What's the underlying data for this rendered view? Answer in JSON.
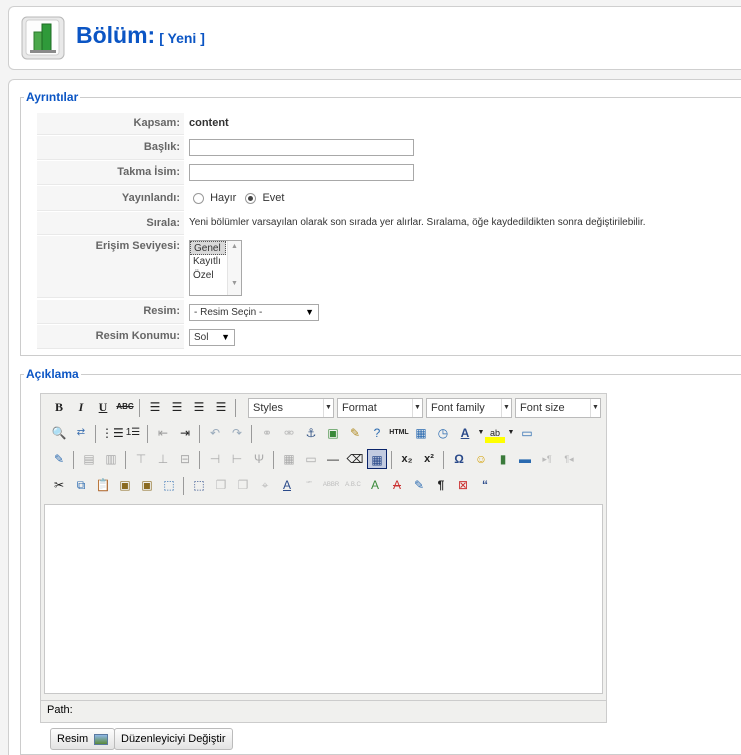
{
  "header": {
    "title": "Bölüm:",
    "subtitle": "[ Yeni ]"
  },
  "details": {
    "legend": "Ayrıntılar",
    "scope_label": "Kapsam:",
    "scope_value": "content",
    "title_label": "Başlık:",
    "title_value": "",
    "alias_label": "Takma İsim:",
    "alias_value": "",
    "published_label": "Yayınlandı:",
    "published_no": "Hayır",
    "published_yes": "Evet",
    "order_label": "Sırala:",
    "order_text": "Yeni bölümler varsayılan olarak son sırada yer alırlar. Sıralama, öğe kaydedildikten sonra değiştirilebilir.",
    "access_label": "Erişim Seviyesi:",
    "access_options": [
      "Genel",
      "Kayıtlı",
      "Özel"
    ],
    "image_label": "Resim:",
    "image_selected": "- Resim Seçin -",
    "image_pos_label": "Resim Konumu:",
    "image_pos_selected": "Sol"
  },
  "description": {
    "legend": "Açıklama",
    "styles_dd": "Styles",
    "format_dd": "Format",
    "font_family_dd": "Font family",
    "font_size_dd": "Font size",
    "path_label": "Path:"
  },
  "buttons": {
    "image": "Resim",
    "toggle_editor": "Düzenleyiciyi Değiştir"
  }
}
